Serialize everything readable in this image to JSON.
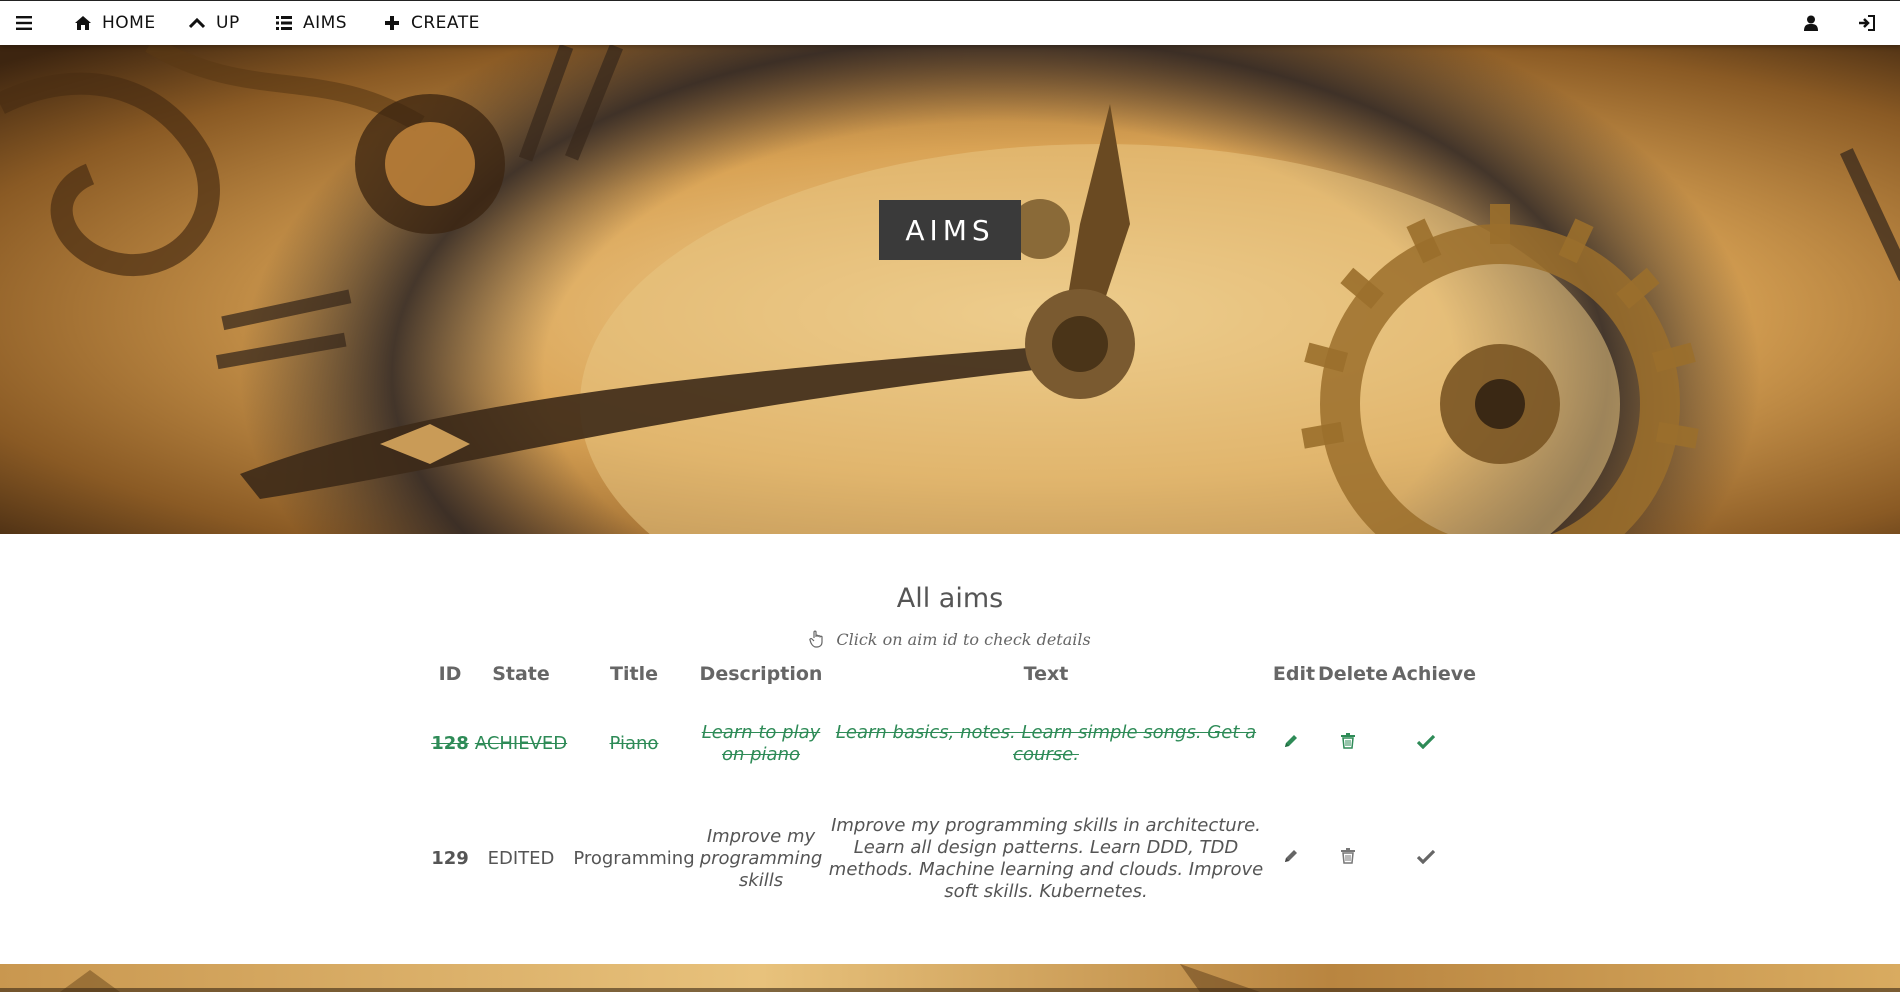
{
  "nav": {
    "home": "HOME",
    "up": "UP",
    "aims": "AIMS",
    "create": "CREATE",
    "icons": [
      "menu-icon",
      "home-icon",
      "chevron-up-icon",
      "list-icon",
      "plus-icon",
      "user-icon",
      "sign-in-icon"
    ]
  },
  "hero": {
    "title": "AIMS"
  },
  "main": {
    "heading": "All aims",
    "hint": "Click on aim id to check details"
  },
  "table": {
    "headers": [
      "ID",
      "State",
      "Title",
      "Description",
      "Text",
      "Edit",
      "Delete",
      "Achieve"
    ],
    "rows": [
      {
        "id": "128",
        "state": "ACHIEVED",
        "title": "Piano",
        "description_lines": [
          "Learn to play",
          "on piano"
        ],
        "text_lines": [
          "Learn basics, notes. Learn simple songs. Get a",
          "course."
        ],
        "achieved": true
      },
      {
        "id": "129",
        "state": "EDITED",
        "title": "Programming",
        "description_lines": [
          "Improve my",
          "programming",
          "skills"
        ],
        "text_lines": [
          "Improve my programming skills in architecture.",
          "Learn all design patterns. Learn DDD, TDD",
          "methods. Machine learning and clouds. Improve",
          "soft skills. Kubernetes."
        ],
        "achieved": false
      }
    ]
  },
  "colors": {
    "achieved": "#2e8b57",
    "text": "#555555",
    "badge": "#3a3a3a"
  }
}
